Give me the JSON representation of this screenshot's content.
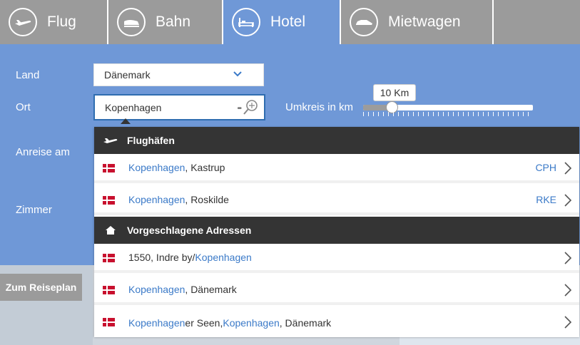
{
  "tabs": [
    {
      "label": "Flug",
      "icon": "plane-icon"
    },
    {
      "label": "Bahn",
      "icon": "train-icon"
    },
    {
      "label": "Hotel",
      "icon": "bed-icon",
      "active": true
    },
    {
      "label": "Mietwagen",
      "icon": "car-icon"
    }
  ],
  "form": {
    "land_label": "Land",
    "land_value": "Dänemark",
    "ort_label": "Ort",
    "ort_value": "Kopenhagen",
    "umkreis_label": "Umkreis in km",
    "umkreis_value": "10 Km",
    "anreise_label": "Anreise am",
    "zimmer_label": "Zimmer"
  },
  "reiseplan_button": "Zum Reiseplan",
  "dropdown": {
    "airports_header": "Flughäfen",
    "airports": [
      {
        "match": "Kopenhagen",
        "rest": ", Kastrup",
        "code": "CPH"
      },
      {
        "match": "Kopenhagen",
        "rest": ", Roskilde",
        "code": "RKE"
      }
    ],
    "addresses_header": "Vorgeschlagene Adressen",
    "addresses": [
      {
        "pre": "1550, Indre by/",
        "match": "Kopenhagen",
        "rest": ""
      },
      {
        "pre": "",
        "match": "Kopenhagen",
        "rest": ", Dänemark"
      },
      {
        "pre": "",
        "match": "Kopenhagen",
        "rest": "er Seen, ",
        "match2": "Kopenhagen",
        "rest2": ", Dänemark"
      }
    ]
  },
  "colors": {
    "panel_blue": "#6f98d7",
    "tab_gray": "#9b9b9b",
    "highlight_blue": "#3b7ac8",
    "header_dark": "#343434"
  }
}
